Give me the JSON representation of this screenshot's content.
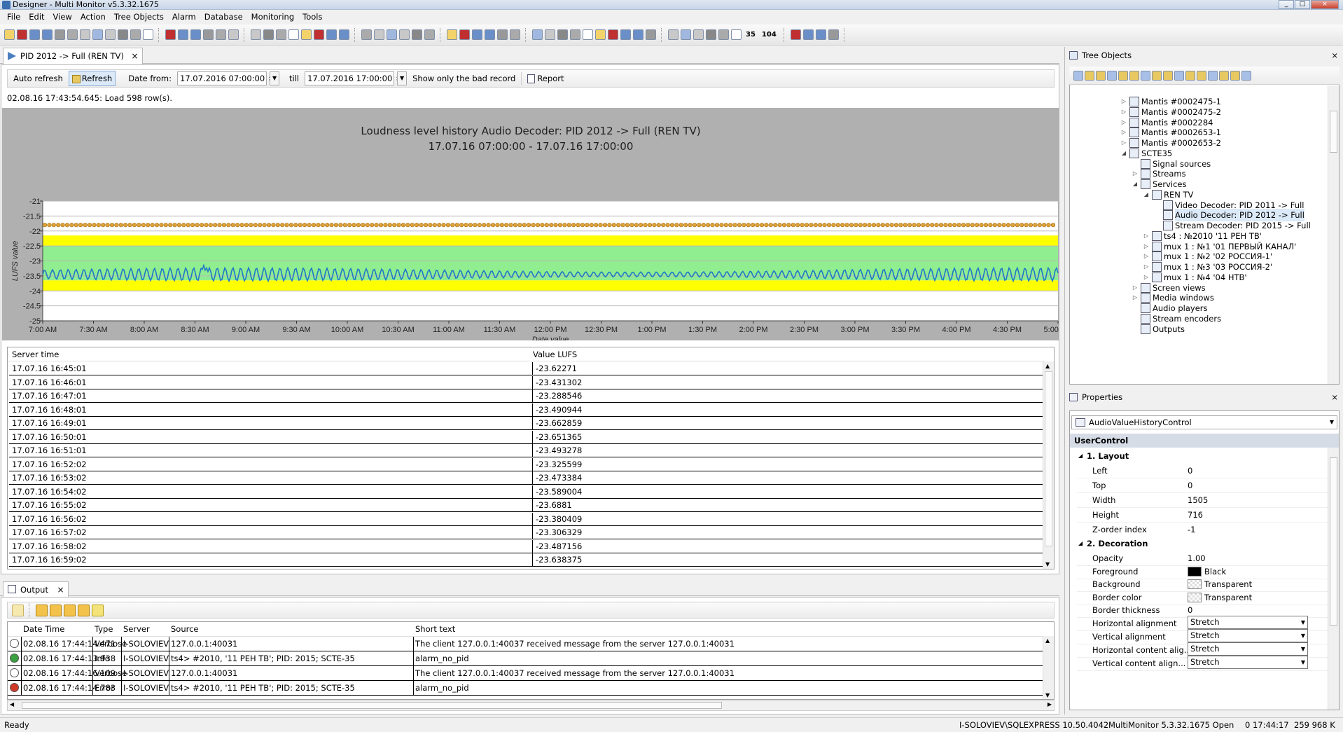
{
  "window": {
    "title": "Designer - Multi Monitor v5.3.32.1675",
    "controls": [
      "_",
      "□",
      "×"
    ]
  },
  "menu": [
    "File",
    "Edit",
    "View",
    "Action",
    "Tree Objects",
    "Alarm",
    "Database",
    "Monitoring",
    "Tools"
  ],
  "toolbar": {
    "badge1": "35",
    "badge2": "104"
  },
  "doc_tab": {
    "label": "PID 2012 -> Full (REN TV)",
    "close": "×"
  },
  "filter": {
    "auto_refresh": "Auto refresh",
    "refresh": "Refresh",
    "date_from_label": "Date from:",
    "date_from": "17.07.2016 07:00:00",
    "till_label": "till",
    "date_till": "17.07.2016 17:00:00",
    "bad_record": "Show only the bad record",
    "report": "Report"
  },
  "load_message": "02.08.16 17:43:54.645: Load 598 row(s).",
  "chart_data": {
    "type": "line",
    "title": "Loudness level history Audio Decoder: PID 2012 -> Full (REN TV)",
    "subtitle": "17.07.16 07:00:00 - 17.07.16 17:00:00",
    "xlabel": "Date value",
    "ylabel": "LUFS value",
    "ylim": [
      -25,
      -21
    ],
    "xlim": [
      "7:00 AM",
      "5:00 PM"
    ],
    "x_ticks": [
      "7:00 AM",
      "7:30 AM",
      "8:00 AM",
      "8:30 AM",
      "9:00 AM",
      "9:30 AM",
      "10:00 AM",
      "10:30 AM",
      "11:00 AM",
      "11:30 AM",
      "12:00 PM",
      "12:30 PM",
      "1:00 PM",
      "1:30 PM",
      "2:00 PM",
      "2:30 PM",
      "3:00 PM",
      "3:30 PM",
      "4:00 PM",
      "4:30 PM",
      "5:00 PM"
    ],
    "y_ticks": [
      "-21",
      "-21.5",
      "-22",
      "-22.5",
      "-23",
      "-23.5",
      "-24",
      "-24.5",
      "-25"
    ],
    "grid": true,
    "bands": [
      {
        "from": -22.15,
        "to": -22.5,
        "color": "#ffff00"
      },
      {
        "from": -22.5,
        "to": -23.65,
        "color": "#90ee90"
      },
      {
        "from": -23.65,
        "to": -24.0,
        "color": "#ffff00"
      }
    ],
    "upper_marker_level": -21.8,
    "marker_color": "#e0a23a",
    "series": [
      {
        "values_mean": -23.45,
        "oscillation_amplitude": 0.2,
        "color": "#1e78c8"
      }
    ]
  },
  "table": {
    "headers": [
      "Server time",
      "Value LUFS"
    ],
    "rows": [
      [
        "17.07.16 16:45:01",
        "-23.62271"
      ],
      [
        "17.07.16 16:46:01",
        "-23.431302"
      ],
      [
        "17.07.16 16:47:01",
        "-23.288546"
      ],
      [
        "17.07.16 16:48:01",
        "-23.490944"
      ],
      [
        "17.07.16 16:49:01",
        "-23.662859"
      ],
      [
        "17.07.16 16:50:01",
        "-23.651365"
      ],
      [
        "17.07.16 16:51:01",
        "-23.493278"
      ],
      [
        "17.07.16 16:52:02",
        "-23.325599"
      ],
      [
        "17.07.16 16:53:02",
        "-23.473384"
      ],
      [
        "17.07.16 16:54:02",
        "-23.589004"
      ],
      [
        "17.07.16 16:55:02",
        "-23.6881"
      ],
      [
        "17.07.16 16:56:02",
        "-23.380409"
      ],
      [
        "17.07.16 16:57:02",
        "-23.306329"
      ],
      [
        "17.07.16 16:58:02",
        "-23.487156"
      ],
      [
        "17.07.16 16:59:02",
        "-23.638375"
      ]
    ]
  },
  "output": {
    "tab_label": "Output",
    "headers": [
      "Date Time",
      "Type",
      "Server",
      "Source",
      "Short text"
    ],
    "rows": [
      {
        "icon": "info",
        "cells": [
          "02.08.16 17:44:14.471",
          "Verbose",
          "I-SOLOVIEV",
          "127.0.0.1:40031",
          "The client 127.0.0.1:40037 received message from the server 127.0.0.1:40031"
        ]
      },
      {
        "icon": "ok",
        "cells": [
          "02.08.16 17:44:13.938",
          "Info",
          "I-SOLOVIEV",
          "ts4> #2010, '11 PEH TB'; PID: 2015; SCTE-35",
          "alarm_no_pid"
        ]
      },
      {
        "icon": "info",
        "cells": [
          "02.08.16 17:44:16.109",
          "Verbose",
          "I-SOLOVIEV",
          "127.0.0.1:40031",
          "The client 127.0.0.1:40037 received message from the server 127.0.0.1:40031"
        ]
      },
      {
        "icon": "error",
        "cells": [
          "02.08.16 17:44:14.783",
          "Error",
          "I-SOLOVIEV",
          "ts4> #2010, '11 PEH TB'; PID: 2015; SCTE-35",
          "alarm_no_pid"
        ]
      }
    ]
  },
  "tree": {
    "title": "Tree Objects",
    "nodes": [
      {
        "label": "Mantis #0002475-1",
        "level": 0,
        "exp": "▷"
      },
      {
        "label": "Mantis #0002475-2",
        "level": 0,
        "exp": "▷"
      },
      {
        "label": "Mantis #0002284",
        "level": 0,
        "exp": "▷"
      },
      {
        "label": "Mantis #0002653-1",
        "level": 0,
        "exp": "▷"
      },
      {
        "label": "Mantis #0002653-2",
        "level": 0,
        "exp": "▷"
      },
      {
        "label": "SCTE35",
        "level": 0,
        "exp": "◢"
      },
      {
        "label": "Signal sources",
        "level": 1,
        "exp": ""
      },
      {
        "label": "Streams",
        "level": 1,
        "exp": "▷"
      },
      {
        "label": "Services",
        "level": 1,
        "exp": "◢"
      },
      {
        "label": "REN TV",
        "level": 2,
        "exp": "◢"
      },
      {
        "label": "Video Decoder: PID 2011 -> Full",
        "level": 3,
        "exp": ""
      },
      {
        "label": "Audio Decoder: PID 2012 -> Full",
        "level": 3,
        "exp": "",
        "selected": true
      },
      {
        "label": "Stream Decoder: PID 2015 -> Full",
        "level": 3,
        "exp": ""
      },
      {
        "label": "ts4 : №2010 '11 РЕН ТВ'",
        "level": 2,
        "exp": "▷"
      },
      {
        "label": "mux 1 : №1 '01 ПЕРВЫЙ КАНАЛ'",
        "level": 2,
        "exp": "▷"
      },
      {
        "label": "mux 1 : №2 '02 РОССИЯ-1'",
        "level": 2,
        "exp": "▷"
      },
      {
        "label": "mux 1 : №3 '03 РОССИЯ-2'",
        "level": 2,
        "exp": "▷"
      },
      {
        "label": "mux 1 : №4 '04 НТВ'",
        "level": 2,
        "exp": "▷"
      },
      {
        "label": "Screen views",
        "level": 1,
        "exp": "▷"
      },
      {
        "label": "Media windows",
        "level": 1,
        "exp": "▷"
      },
      {
        "label": "Audio players",
        "level": 1,
        "exp": ""
      },
      {
        "label": "Stream encoders",
        "level": 1,
        "exp": ""
      },
      {
        "label": "Outputs",
        "level": 1,
        "exp": ""
      }
    ]
  },
  "properties": {
    "title": "Properties",
    "object": "AudioValueHistoryControl",
    "section": "UserControl",
    "layout_cat": "1. Layout",
    "layout": [
      [
        "Left",
        "0"
      ],
      [
        "Top",
        "0"
      ],
      [
        "Width",
        "1505"
      ],
      [
        "Height",
        "716"
      ],
      [
        "Z-order index",
        "-1"
      ]
    ],
    "decoration_cat": "2. Decoration",
    "decoration": [
      {
        "k": "Opacity",
        "v": "1.00"
      },
      {
        "k": "Foreground",
        "v": "Black",
        "swatch": "#000000"
      },
      {
        "k": "Background",
        "v": "Transparent",
        "swatch": "checker"
      },
      {
        "k": "Border color",
        "v": "Transparent",
        "swatch": "checker"
      },
      {
        "k": "Border thickness",
        "v": "0"
      },
      {
        "k": "Horizontal alignment",
        "v": "Stretch",
        "select": true
      },
      {
        "k": "Vertical alignment",
        "v": "Stretch",
        "select": true
      },
      {
        "k": "Horizontal content alig...",
        "v": "Stretch",
        "select": true
      },
      {
        "k": "Vertical content align...",
        "v": "Stretch",
        "select": true
      }
    ]
  },
  "status": {
    "ready": "Ready",
    "db": "I-SOLOVIEV\\SQLEXPRESS 10.50.4042",
    "app": "MultiMonitor 5.3.32.1675 Open",
    "time": "0 17:44:17",
    "mem": "259 968 K"
  }
}
